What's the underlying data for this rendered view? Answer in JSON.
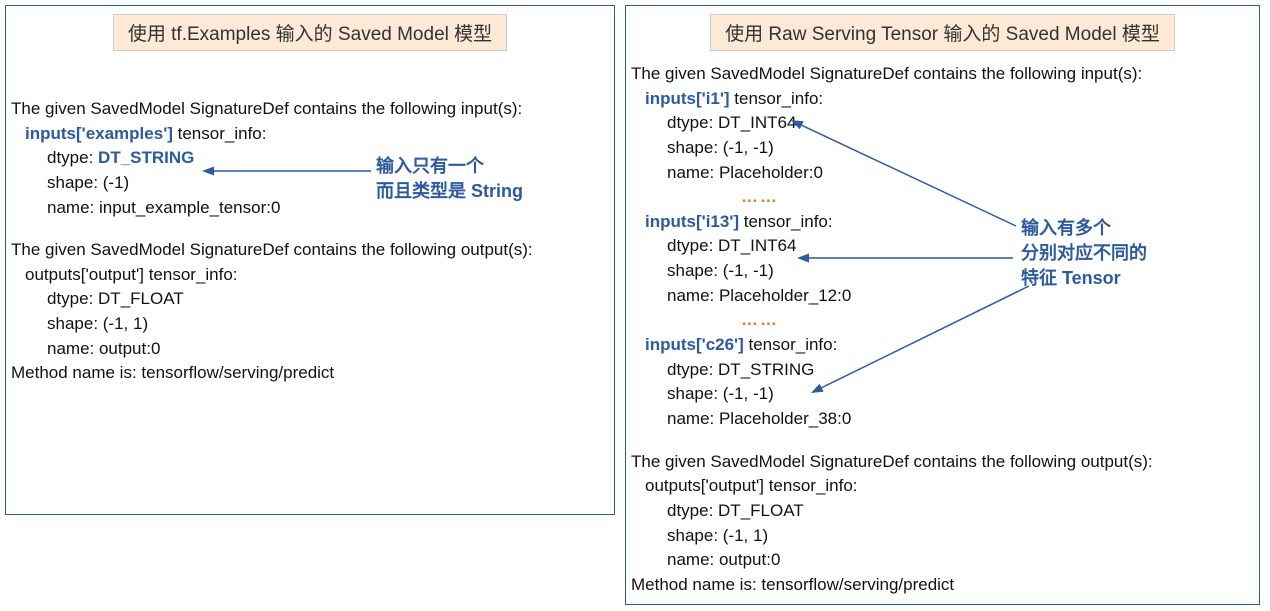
{
  "left": {
    "title": "使用 tf.Examples 输入的 Saved Model 模型",
    "input_header": "The given SavedModel SignatureDef contains the following input(s):",
    "input1_label": "inputs['examples']",
    "tensor_info": " tensor_info:",
    "dtype_label": "dtype: ",
    "dtype_value": "DT_STRING",
    "shape": "shape: (-1)",
    "name": "name: input_example_tensor:0",
    "output_header": "The given SavedModel SignatureDef contains the following output(s):",
    "output_label": "outputs['output'] tensor_info:",
    "out_dtype": "dtype: DT_FLOAT",
    "out_shape": "shape: (-1, 1)",
    "out_name": "name: output:0",
    "method": "Method name is: tensorflow/serving/predict",
    "annotation_l1": "输入只有一个",
    "annotation_l2": "而且类型是 String"
  },
  "right": {
    "title": "使用 Raw Serving Tensor  输入的 Saved Model 模型",
    "input_header": "The given SavedModel SignatureDef contains the following input(s):",
    "i1_label": "inputs['i1']",
    "i1_dtype": "dtype: DT_INT64",
    "i1_shape": "shape: (-1, -1)",
    "i1_name": "name: Placeholder:0",
    "dots": "……",
    "i13_label": "inputs['i13']",
    "i13_dtype": "dtype: DT_INT64",
    "i13_shape": "shape: (-1, -1)",
    "i13_name": "name: Placeholder_12:0",
    "c26_label": "inputs['c26']",
    "c26_dtype": "dtype: DT_STRING",
    "c26_shape": "shape: (-1, -1)",
    "c26_name": "name: Placeholder_38:0",
    "tensor_info": " tensor_info:",
    "output_header": "The given SavedModel SignatureDef contains the following output(s):",
    "output_label": "outputs['output'] tensor_info:",
    "out_dtype": "dtype: DT_FLOAT",
    "out_shape": "shape: (-1, 1)",
    "out_name": "name: output:0",
    "method": "Method name is: tensorflow/serving/predict",
    "annotation_l1": "输入有多个",
    "annotation_l2": "分别对应不同的",
    "annotation_l3": "特征 Tensor"
  }
}
